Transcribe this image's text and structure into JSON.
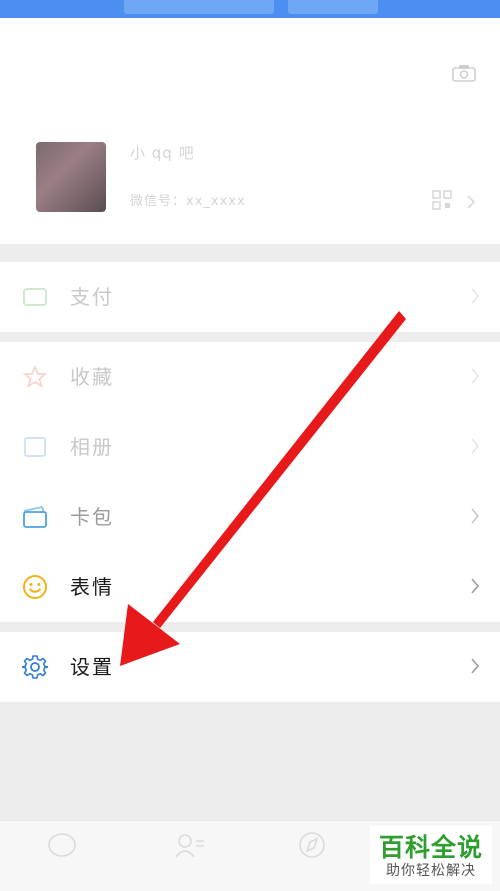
{
  "profile": {
    "nickname": "小 qq 吧",
    "wechat_id": "微信号：xx_xxxx",
    "qr_icon": "qr-code-icon",
    "camera_icon": "camera-icon"
  },
  "menu": {
    "pay": {
      "label": "支付",
      "icon": "pay-icon"
    },
    "favorites": {
      "label": "收藏",
      "icon": "favorites-icon"
    },
    "album": {
      "label": "相册",
      "icon": "album-icon"
    },
    "cards": {
      "label": "卡包",
      "icon": "card-wallet-icon"
    },
    "stickers": {
      "label": "表情",
      "icon": "smiley-icon"
    },
    "settings": {
      "label": "设置",
      "icon": "gear-icon"
    }
  },
  "colors": {
    "status_bar": "#4c8ff0",
    "annotation_arrow": "#e8191b",
    "settings_icon": "#2f7fd8",
    "sticker_icon": "#f0b21a",
    "card_icon": "#4aa3df",
    "badge_green": "#2e9e2e"
  },
  "tabbar": {
    "tabs": [
      {
        "icon": "chat-icon"
      },
      {
        "icon": "contacts-icon"
      },
      {
        "icon": "discover-icon"
      },
      {
        "icon": "me-icon"
      }
    ]
  },
  "watermark": {
    "title": "百科全说",
    "subtitle": "助你轻松解决"
  }
}
